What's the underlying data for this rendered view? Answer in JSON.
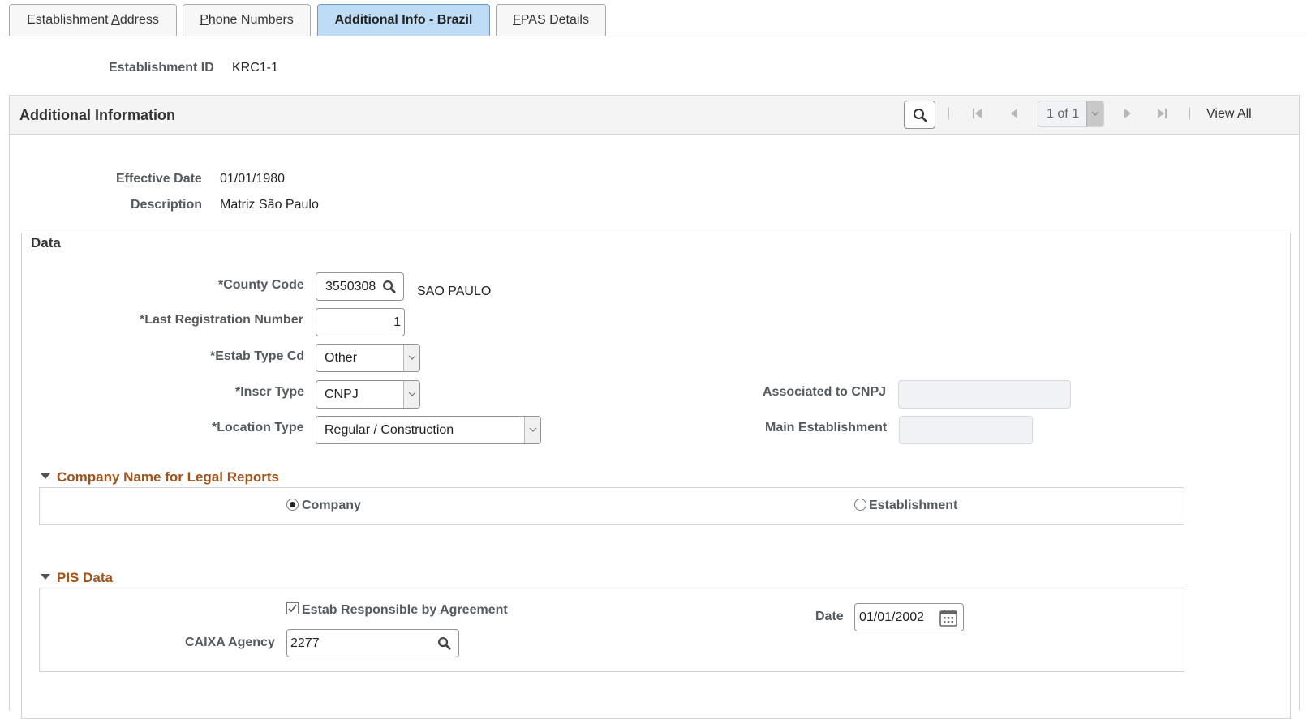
{
  "tabs": [
    {
      "label_pre": "Establishment ",
      "accel": "A",
      "label_post": "ddress",
      "active": false
    },
    {
      "label_pre": "",
      "accel": "P",
      "label_post": "hone Numbers",
      "active": false
    },
    {
      "label_pre": "Additional Info - Brazil",
      "accel": "",
      "label_post": "",
      "active": true
    },
    {
      "label_pre": "",
      "accel": "F",
      "label_post": "PAS Details",
      "active": false
    }
  ],
  "header": {
    "establishment_id_label": "Establishment ID",
    "establishment_id_value": "KRC1-1"
  },
  "panel": {
    "title": "Additional Information",
    "nav": {
      "search_icon": "search-icon",
      "separator": "|",
      "pager_text": "1 of 1",
      "view_all": "View All"
    },
    "effective_date_label": "Effective Date",
    "effective_date_value": "01/01/1980",
    "description_label": "Description",
    "description_value": "Matriz São Paulo"
  },
  "data": {
    "title": "Data",
    "county_code_label": "*County Code",
    "county_code_value": "3550308",
    "county_name": "SAO PAULO",
    "last_reg_label": "*Last Registration Number",
    "last_reg_value": "1",
    "estab_type_label": "*Estab Type Cd",
    "estab_type_value": "Other",
    "inscr_type_label": "*Inscr Type",
    "inscr_type_value": "CNPJ",
    "location_type_label": "*Location Type",
    "location_type_value": "Regular / Construction",
    "assoc_cnpj_label": "Associated to CNPJ",
    "assoc_cnpj_value": "",
    "main_estab_label": "Main Establishment",
    "main_estab_value": ""
  },
  "company_name_section": {
    "title": "Company Name for Legal Reports",
    "options": [
      {
        "label": "Company",
        "selected": true
      },
      {
        "label": "Establishment",
        "selected": false
      }
    ]
  },
  "pis_section": {
    "title": "PIS Data",
    "estab_responsible_label": "Estab Responsible by Agreement",
    "estab_responsible_checked": true,
    "date_label": "Date",
    "date_value": "01/01/2002",
    "caixa_agency_label": "CAIXA Agency",
    "caixa_agency_value": "2277"
  },
  "colors": {
    "active_tab_bg": "#bfdcf7",
    "section_heading": "#a0521a",
    "label_gray": "#555a5f"
  }
}
